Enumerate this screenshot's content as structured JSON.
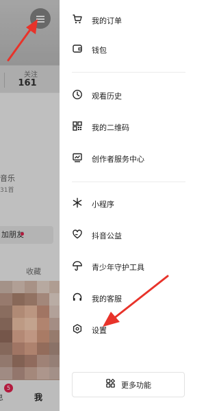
{
  "profile": {
    "following_label": "关注",
    "following_count": "161",
    "music_name": "音乐",
    "music_sub": "31首",
    "add_friend": "加朋友",
    "favorites_tab": "收藏",
    "messages_label": "息",
    "messages_badge": "5",
    "me_tab": "我"
  },
  "drawer": {
    "group1": [
      {
        "label": "我的订单",
        "icon": "cart-icon"
      },
      {
        "label": "钱包",
        "icon": "wallet-icon"
      }
    ],
    "group2": [
      {
        "label": "观看历史",
        "icon": "clock-icon"
      },
      {
        "label": "我的二维码",
        "icon": "qr-code-icon"
      },
      {
        "label": "创作者服务中心",
        "icon": "creator-chart-icon"
      }
    ],
    "group3": [
      {
        "label": "小程序",
        "icon": "mini-program-icon"
      },
      {
        "label": "抖音公益",
        "icon": "charity-heart-icon"
      },
      {
        "label": "青少年守护工具",
        "icon": "umbrella-icon"
      },
      {
        "label": "我的客服",
        "icon": "headset-icon"
      },
      {
        "label": "设置",
        "icon": "settings-hexagon-icon"
      }
    ],
    "more_button": "更多功能"
  },
  "colors": {
    "annotation_arrow": "#e8332a",
    "badge": "#d9214c"
  }
}
